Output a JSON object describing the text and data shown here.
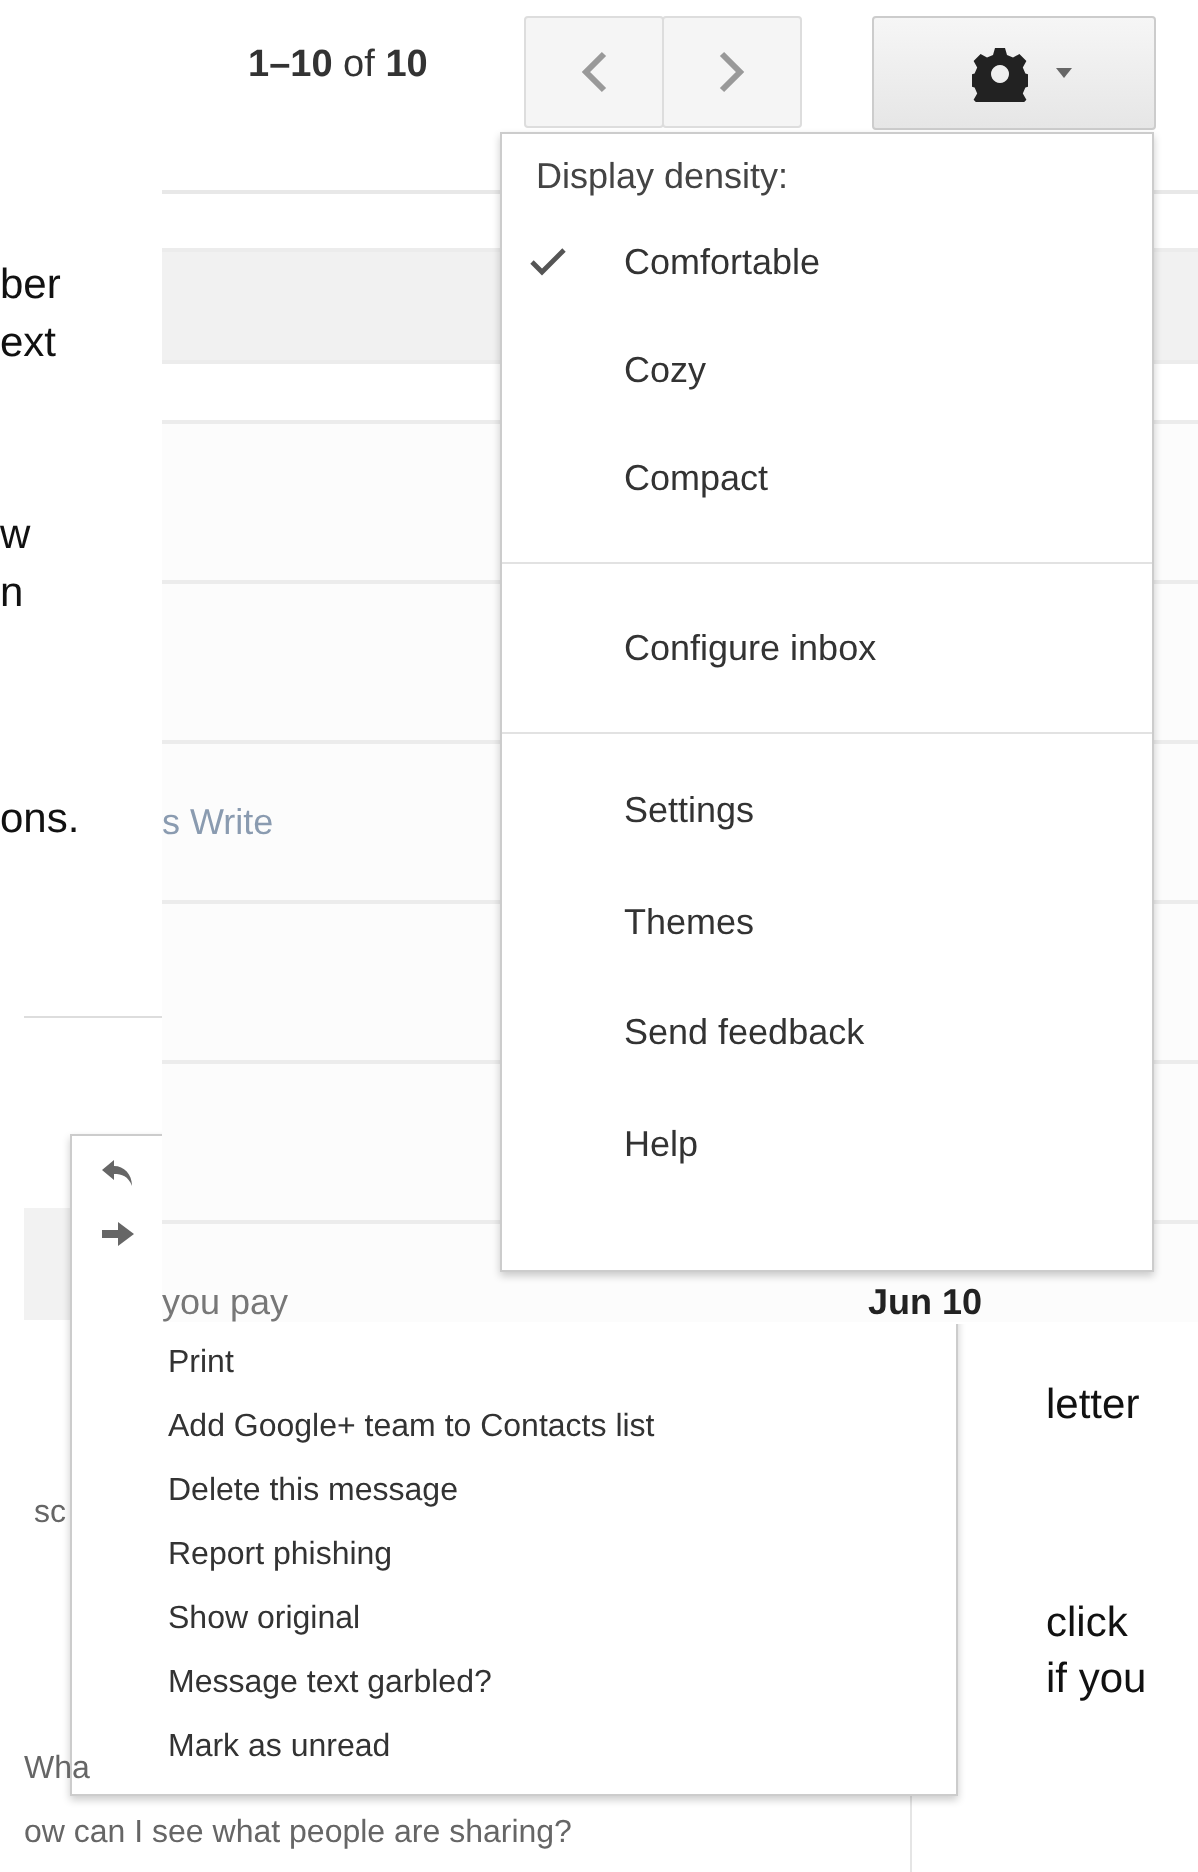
{
  "document_text": {
    "left": [
      "ber",
      "ext",
      "w",
      "n",
      "ons."
    ],
    "right": [
      "letter",
      "click",
      "if you"
    ]
  },
  "toolbar": {
    "page_range": "**1–10** of **10**"
  },
  "settings_menu": {
    "heading": "Display density:",
    "density_options": [
      {
        "label": "Comfortable",
        "selected": true
      },
      {
        "label": "Cozy",
        "selected": false
      },
      {
        "label": "Compact",
        "selected": false
      }
    ],
    "configure": "Configure inbox",
    "items": [
      "Settings",
      "Themes",
      "Send feedback",
      "Help"
    ]
  },
  "inbox_fragment": {
    "snippet": "s Write",
    "subject": "you pay",
    "date": "Jun 10"
  },
  "more_menu": {
    "items": [
      "Print",
      "Add Google+ team to Contacts list",
      "Delete this message",
      "Report phishing",
      "Show original",
      "Message text garbled?",
      "Mark as unread"
    ]
  },
  "background_list": {
    "texts": [
      "sc",
      "Wha",
      "ow can I see what people are sharing?"
    ]
  }
}
